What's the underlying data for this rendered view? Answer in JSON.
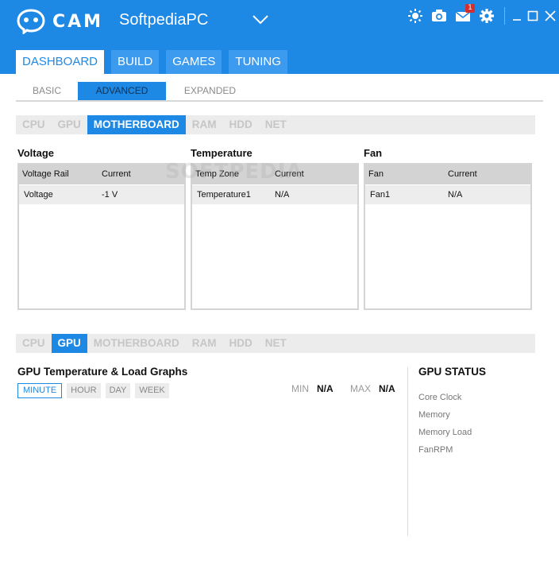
{
  "app": {
    "logo_text": "CAM",
    "profile_name": "SoftpediaPC",
    "notification_count": "1",
    "accent_color": "#1e88e5"
  },
  "header_icons": [
    "brightness-icon",
    "camera-icon",
    "mail-icon",
    "gear-icon",
    "minimize-icon",
    "maximize-icon",
    "close-icon"
  ],
  "main_tabs": [
    {
      "label": "DASHBOARD",
      "active": true
    },
    {
      "label": "BUILD",
      "active": false
    },
    {
      "label": "GAMES",
      "active": false
    },
    {
      "label": "TUNING",
      "active": false
    }
  ],
  "sub_tabs": [
    {
      "label": "BASIC",
      "active": false
    },
    {
      "label": "ADVANCED",
      "active": true
    },
    {
      "label": "EXPANDED",
      "active": false
    }
  ],
  "device_tabs_top": [
    {
      "label": "CPU",
      "active": false
    },
    {
      "label": "GPU",
      "active": false
    },
    {
      "label": "MOTHERBOARD",
      "active": true
    },
    {
      "label": "RAM",
      "active": false
    },
    {
      "label": "HDD",
      "active": false
    },
    {
      "label": "NET",
      "active": false
    }
  ],
  "panels": [
    {
      "title": "Voltage",
      "headers": [
        "Voltage Rail",
        "Current"
      ],
      "rows": [
        [
          "Voltage",
          "-1 V"
        ]
      ]
    },
    {
      "title": "Temperature",
      "headers": [
        "Temp Zone",
        "Current"
      ],
      "rows": [
        [
          "Temperature1",
          "N/A"
        ]
      ]
    },
    {
      "title": "Fan",
      "headers": [
        "Fan",
        "Current"
      ],
      "rows": [
        [
          "Fan1",
          "N/A"
        ]
      ]
    }
  ],
  "watermark": "SOFTPEDIA",
  "device_tabs_bottom": [
    {
      "label": "CPU",
      "active": false
    },
    {
      "label": "GPU",
      "active": true
    },
    {
      "label": "MOTHERBOARD",
      "active": false
    },
    {
      "label": "RAM",
      "active": false
    },
    {
      "label": "HDD",
      "active": false
    },
    {
      "label": "NET",
      "active": false
    }
  ],
  "graph": {
    "title": "GPU Temperature & Load Graphs",
    "ranges": [
      {
        "label": "MINUTE",
        "active": true
      },
      {
        "label": "HOUR",
        "active": false
      },
      {
        "label": "DAY",
        "active": false
      },
      {
        "label": "WEEK",
        "active": false
      }
    ],
    "min_label": "MIN",
    "min_value": "N/A",
    "max_label": "MAX",
    "max_value": "N/A"
  },
  "gpu_status": {
    "title": "GPU STATUS",
    "items": [
      "Core Clock",
      "Memory",
      "Memory Load",
      "FanRPM"
    ]
  }
}
